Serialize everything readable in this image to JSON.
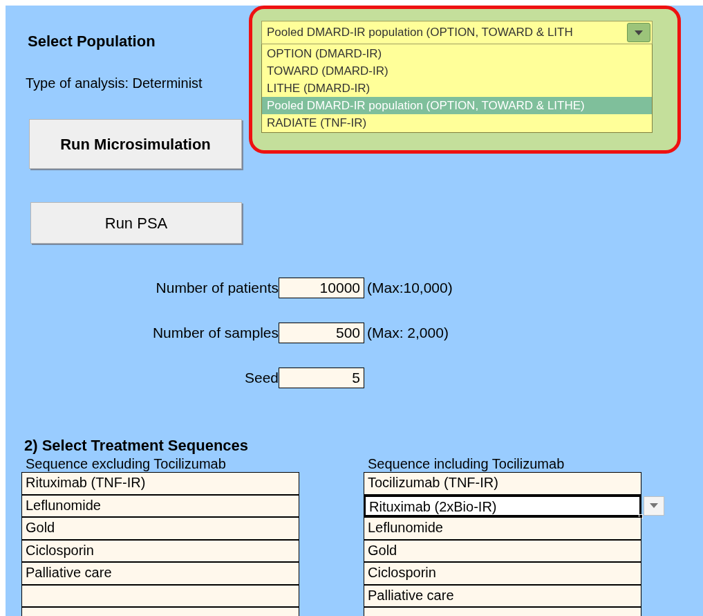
{
  "population_selector": {
    "label": "Select Population",
    "value": "Pooled DMARD-IR population (OPTION, TOWARD & LITH",
    "expanded": true,
    "options": [
      {
        "label": "OPTION (DMARD-IR)",
        "selected": false
      },
      {
        "label": "TOWARD (DMARD-IR)",
        "selected": false
      },
      {
        "label": "LITHE (DMARD-IR)",
        "selected": false
      },
      {
        "label": "Pooled DMARD-IR population (OPTION, TOWARD & LITHE)",
        "selected": true
      },
      {
        "label": "RADIATE (TNF-IR)",
        "selected": false
      }
    ]
  },
  "analysis_type": "Type of analysis: Determinist",
  "buttons": [
    {
      "label": "Run Microsimulation",
      "kind": "primary"
    },
    {
      "label": "Run PSA",
      "kind": "secondary"
    }
  ],
  "inputs": [
    {
      "label": "Number of patients",
      "value": "10000",
      "note": "(Max:10,000)"
    },
    {
      "label": "Number of samples",
      "value": "500",
      "note": "(Max: 2,000)"
    },
    {
      "label": "Seed",
      "value": "5"
    }
  ],
  "treatment_sequences": {
    "title": "2) Select Treatment Sequences",
    "columns": [
      {
        "heading": "Sequence excluding Tocilizumab",
        "items": [
          {
            "text": "Rituximab (TNF-IR)",
            "selected": false
          },
          {
            "text": "Leflunomide",
            "selected": false
          },
          {
            "text": "Gold",
            "selected": false
          },
          {
            "text": "Ciclosporin",
            "selected": false
          },
          {
            "text": "Palliative care",
            "selected": false
          }
        ]
      },
      {
        "heading": "Sequence including Tocilizumab",
        "items": [
          {
            "text": "Tocilizumab (TNF-IR)",
            "selected": false
          },
          {
            "text": "Rituximab (2xBio-IR)",
            "selected": true
          },
          {
            "text": "Leflunomide",
            "selected": false
          },
          {
            "text": "Gold",
            "selected": false
          },
          {
            "text": "Ciclosporin",
            "selected": false
          },
          {
            "text": "Palliative care",
            "selected": false
          }
        ]
      }
    ]
  }
}
